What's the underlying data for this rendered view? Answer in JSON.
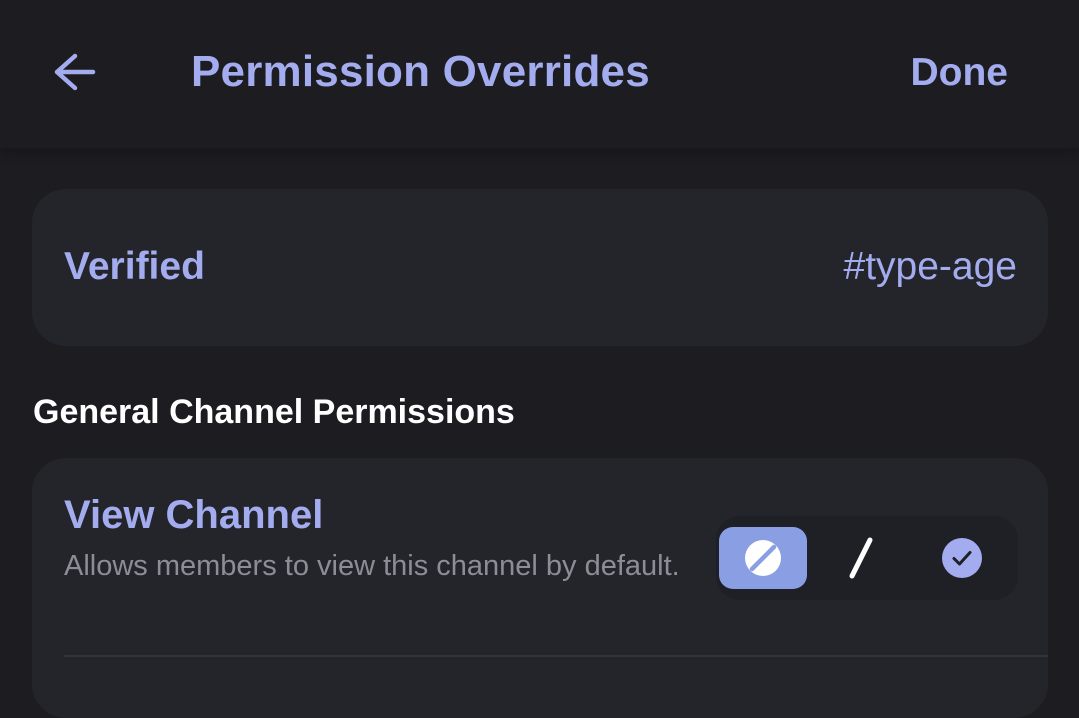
{
  "header": {
    "back_icon": "arrow-left-icon",
    "title": "Permission Overrides",
    "done_label": "Done"
  },
  "override_target": {
    "role": "Verified",
    "channel": "#type-age"
  },
  "section": {
    "title": "General Channel Permissions"
  },
  "permissions": [
    {
      "name": "View Channel",
      "description": "Allows members to view this channel by default.",
      "state": "deny",
      "options": [
        {
          "id": "deny",
          "icon": "deny-circle-slash-icon"
        },
        {
          "id": "neutral",
          "icon": "slash-icon"
        },
        {
          "id": "allow",
          "icon": "check-circle-icon"
        }
      ]
    }
  ],
  "colors": {
    "background": "#1c1c21",
    "card": "#24242b",
    "accent": "#a3acef",
    "deny_selected": "#8a9ee3",
    "muted_text": "#8c8d96"
  }
}
